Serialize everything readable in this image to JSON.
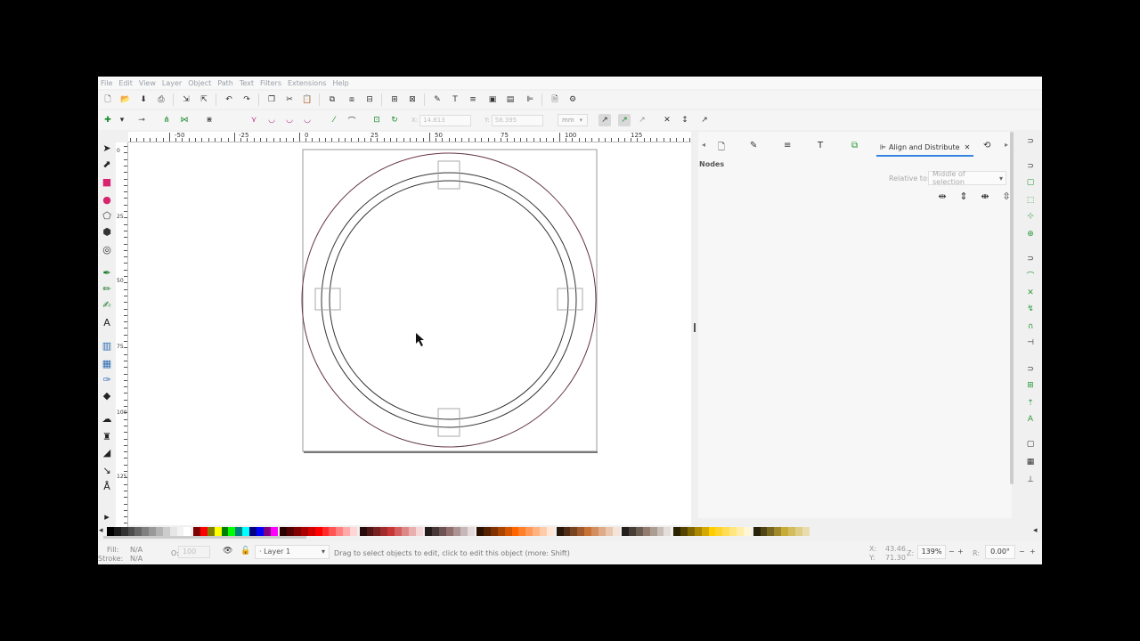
{
  "menu": [
    "File",
    "Edit",
    "View",
    "Layer",
    "Object",
    "Path",
    "Text",
    "Filters",
    "Extensions",
    "Help"
  ],
  "commands": [
    {
      "icon": "new-doc-icon",
      "glyph": "🗋"
    },
    {
      "icon": "open-icon",
      "glyph": "📂"
    },
    {
      "icon": "save-icon",
      "glyph": "⬇"
    },
    {
      "icon": "print-icon",
      "glyph": "⎙"
    },
    {
      "icon": "import-icon",
      "glyph": "⇲"
    },
    {
      "icon": "export-icon",
      "glyph": "⇱"
    },
    {
      "icon": "undo-icon",
      "glyph": "↶"
    },
    {
      "icon": "redo-icon",
      "glyph": "↷"
    },
    {
      "icon": "copy-icon",
      "glyph": "❐"
    },
    {
      "icon": "cut-icon",
      "glyph": "✂"
    },
    {
      "icon": "paste-icon",
      "glyph": "📋"
    },
    {
      "icon": "duplicate-icon",
      "glyph": "⧉"
    },
    {
      "icon": "clone-icon",
      "glyph": "⧈"
    },
    {
      "icon": "unlink-clone-icon",
      "glyph": "⊟"
    },
    {
      "icon": "group-icon",
      "glyph": "⊞"
    },
    {
      "icon": "ungroup-icon",
      "glyph": "⊠"
    },
    {
      "icon": "xml-editor-icon",
      "glyph": "✎"
    },
    {
      "icon": "text-font-icon",
      "glyph": "T"
    },
    {
      "icon": "layers-icon",
      "glyph": "≡"
    },
    {
      "icon": "objects-icon",
      "glyph": "▣"
    },
    {
      "icon": "selectors-icon",
      "glyph": "▤"
    },
    {
      "icon": "align-icon",
      "glyph": "⊫"
    },
    {
      "icon": "document-props-icon",
      "glyph": "🗎"
    },
    {
      "icon": "preferences-icon",
      "glyph": "⚙"
    }
  ],
  "node_controls": [
    {
      "icon": "insert-node-icon",
      "glyph": "✚",
      "tone": "green"
    },
    {
      "icon": "delete-node-icon",
      "glyph": "▾",
      "tone": ""
    },
    {
      "icon": "join-nodes-icon",
      "glyph": "⊸",
      "tone": ""
    },
    {
      "icon": "break-path-icon",
      "glyph": "⋔",
      "tone": "green"
    },
    {
      "icon": "join-endnodes-icon",
      "glyph": "⋈",
      "tone": "green"
    },
    {
      "icon": "delete-segment-icon",
      "glyph": "⋇",
      "tone": ""
    },
    {
      "icon": "corner-node-icon",
      "glyph": "⋎",
      "tone": "pink"
    },
    {
      "icon": "smooth-node-icon",
      "glyph": "◡",
      "tone": "pink"
    },
    {
      "icon": "symmetric-node-icon",
      "glyph": "◡",
      "tone": "pink"
    },
    {
      "icon": "auto-smooth-icon",
      "glyph": "◡",
      "tone": "pink"
    },
    {
      "icon": "make-line-icon",
      "glyph": "⁄",
      "tone": "green"
    },
    {
      "icon": "make-curve-icon",
      "glyph": "⌒",
      "tone": ""
    },
    {
      "icon": "object-to-path-icon",
      "glyph": "⊡",
      "tone": "green"
    },
    {
      "icon": "stroke-to-path-icon",
      "glyph": "↻",
      "tone": "green"
    }
  ],
  "coords": {
    "x_label": "X:",
    "x_value": "14.813",
    "y_label": "Y:",
    "y_value": "58.395",
    "unit": "mm"
  },
  "ctrl_right": [
    {
      "icon": "show-path-outline-icon",
      "glyph": "↗"
    },
    {
      "icon": "show-handles-icon",
      "glyph": "↗"
    },
    {
      "icon": "show-clipping-icon",
      "glyph": "↗"
    },
    {
      "icon": "show-transform-handles-icon",
      "glyph": "✕"
    },
    {
      "icon": "show-bbox-icon",
      "glyph": "↕"
    },
    {
      "icon": "next-path-effect-icon",
      "glyph": "↗"
    }
  ],
  "tools": [
    {
      "icon": "selector-tool-icon",
      "glyph": "➤",
      "color": "#222"
    },
    {
      "icon": "node-tool-icon",
      "glyph": "⬈",
      "color": "#222"
    },
    {
      "icon": "rect-tool-icon",
      "glyph": "■",
      "color": "#d6246e"
    },
    {
      "icon": "ellipse-tool-icon",
      "glyph": "●",
      "color": "#d6246e"
    },
    {
      "icon": "star-tool-icon",
      "glyph": "⬠",
      "color": "#333"
    },
    {
      "icon": "3dbox-tool-icon",
      "glyph": "⬢",
      "color": "#333"
    },
    {
      "icon": "spiral-tool-icon",
      "glyph": "◎",
      "color": "#333"
    },
    {
      "icon": "pen-tool-icon",
      "glyph": "✒",
      "color": "#1a7a2a"
    },
    {
      "icon": "pencil-tool-icon",
      "glyph": "✏",
      "color": "#1a7a2a"
    },
    {
      "icon": "calligraphy-tool-icon",
      "glyph": "✍",
      "color": "#1a7a2a"
    },
    {
      "icon": "text-tool-icon",
      "glyph": "A",
      "color": "#222"
    },
    {
      "icon": "gradient-tool-icon",
      "glyph": "▥",
      "color": "#2a6ab0"
    },
    {
      "icon": "mesh-tool-icon",
      "glyph": "▦",
      "color": "#2a6ab0"
    },
    {
      "icon": "dropper-tool-icon",
      "glyph": "✑",
      "color": "#2a6ab0"
    },
    {
      "icon": "paint-bucket-tool-icon",
      "glyph": "◆",
      "color": "#222"
    },
    {
      "icon": "tweak-tool-icon",
      "glyph": "☁",
      "color": "#222"
    },
    {
      "icon": "spray-tool-icon",
      "glyph": "♜",
      "color": "#222"
    },
    {
      "icon": "eraser-tool-icon",
      "glyph": "◢",
      "color": "#222"
    },
    {
      "icon": "connector-tool-icon",
      "glyph": "↘",
      "color": "#222"
    },
    {
      "icon": "measure-tool-icon",
      "glyph": "Å",
      "color": "#222"
    },
    {
      "icon": "expand-tools-icon",
      "glyph": "▸",
      "color": "#222"
    }
  ],
  "hruler": [
    "-50",
    "-25",
    "0",
    "25",
    "50",
    "75",
    "100",
    "125"
  ],
  "vruler": [
    "0",
    "25",
    "50",
    "75",
    "100",
    "125"
  ],
  "dock": {
    "tabs": [
      {
        "icon": "doc-props-tab-icon",
        "glyph": "🗋"
      },
      {
        "icon": "xml-tab-icon",
        "glyph": "✎"
      },
      {
        "icon": "layers-tab-icon",
        "glyph": "≡"
      },
      {
        "icon": "text-tab-icon",
        "glyph": "T"
      },
      {
        "icon": "export-tab-icon",
        "glyph": "⧉"
      }
    ],
    "active_tab": "Align and Distribute",
    "section": "Nodes",
    "relative_label": "Relative to:",
    "relative_value": "Middle of selection",
    "buttons": [
      {
        "icon": "align-nodes-horizontal-icon",
        "glyph": "⇹"
      },
      {
        "icon": "align-nodes-vertical-icon",
        "glyph": "⇕"
      },
      {
        "icon": "distribute-nodes-horizontal-icon",
        "glyph": "⇼"
      },
      {
        "icon": "distribute-nodes-vertical-icon",
        "glyph": "⇳"
      }
    ]
  },
  "snap": [
    {
      "icon": "snap-toggle-icon",
      "glyph": "⊃",
      "tone": ""
    },
    {
      "icon": "snap-bbox-icon",
      "glyph": "⊃",
      "tone": ""
    },
    {
      "icon": "snap-bbox-edge-icon",
      "glyph": "▢",
      "tone": "green"
    },
    {
      "icon": "snap-bbox-corner-icon",
      "glyph": "⬚",
      "tone": "green"
    },
    {
      "icon": "snap-bbox-midpoint-icon",
      "glyph": "⊹",
      "tone": "green"
    },
    {
      "icon": "snap-bbox-center-icon",
      "glyph": "⊕",
      "tone": "green"
    },
    {
      "icon": "snap-nodes-icon",
      "glyph": "⊃",
      "tone": ""
    },
    {
      "icon": "snap-path-icon",
      "glyph": "⌒",
      "tone": "green"
    },
    {
      "icon": "snap-intersection-icon",
      "glyph": "✕",
      "tone": "green"
    },
    {
      "icon": "snap-cusp-icon",
      "glyph": "↯",
      "tone": "green"
    },
    {
      "icon": "snap-smooth-icon",
      "glyph": "∩",
      "tone": "green"
    },
    {
      "icon": "snap-midpoint-icon",
      "glyph": "⊣",
      "tone": ""
    },
    {
      "icon": "snap-others-icon",
      "glyph": "⊃",
      "tone": ""
    },
    {
      "icon": "snap-object-center-icon",
      "glyph": "⊞",
      "tone": "green"
    },
    {
      "icon": "snap-rotation-center-icon",
      "glyph": "⇡",
      "tone": "green"
    },
    {
      "icon": "snap-text-baseline-icon",
      "glyph": "A",
      "tone": "green"
    },
    {
      "icon": "snap-page-icon",
      "glyph": "▢",
      "tone": ""
    },
    {
      "icon": "snap-grid-icon",
      "glyph": "▦",
      "tone": ""
    },
    {
      "icon": "snap-guide-icon",
      "glyph": "⊥",
      "tone": ""
    }
  ],
  "palette_colors": [
    "#000000",
    "#1a1a1a",
    "#333333",
    "#4d4d4d",
    "#666666",
    "#808080",
    "#999999",
    "#b3b3b3",
    "#cccccc",
    "#e6e6e6",
    "#f2f2f2",
    "#ffffff",
    "#800000",
    "#ff0000",
    "#808000",
    "#ffff00",
    "#008000",
    "#00ff00",
    "#008080",
    "#00ffff",
    "#000080",
    "#0000ff",
    "#800080",
    "#ff00ff",
    "#2b0000",
    "#550000",
    "#800000",
    "#aa0000",
    "#d40000",
    "#ff0000",
    "#ff2a2a",
    "#ff5555",
    "#ff8080",
    "#ffaaaa",
    "#ffd5d5",
    "#280b0b",
    "#501616",
    "#782121",
    "#a02c2c",
    "#c83737",
    "#d35f5f",
    "#de8787",
    "#e9afaf",
    "#f4d7d7",
    "#241c1c",
    "#483737",
    "#6c5353",
    "#916f6f",
    "#ac9393",
    "#c8b7b7",
    "#e3dbdb",
    "#2b1100",
    "#552200",
    "#803300",
    "#aa4400",
    "#d45500",
    "#ff6600",
    "#ff7f2a",
    "#ff9955",
    "#ffb380",
    "#ffccaa",
    "#ffe6d5",
    "#28170b",
    "#502d16",
    "#784421",
    "#a05a2c",
    "#c87137",
    "#d38d5f",
    "#deaa87",
    "#e9c6af",
    "#f4e3d7",
    "#241f1c",
    "#483e37",
    "#6c5d53",
    "#917c6f",
    "#ac9d93",
    "#c8beb7",
    "#e3dedb",
    "#2b2200",
    "#554400",
    "#806600",
    "#aa8800",
    "#d4aa00",
    "#ffcc00",
    "#ffd42a",
    "#ffdd55",
    "#ffe680",
    "#ffeeaa",
    "#fff6d5",
    "#28220b",
    "#504416",
    "#786721",
    "#a0892c",
    "#c8ab37",
    "#d3bc5f",
    "#decd87",
    "#e9ddaf"
  ],
  "status": {
    "fill_label": "Fill:",
    "fill_value": "N/A",
    "stroke_label": "Stroke:",
    "stroke_value": "N/A",
    "opacity_label": "O:",
    "opacity_value": "100",
    "layer": "Layer 1",
    "message": "Drag to select objects to edit, click to edit this object (more: Shift)",
    "x_label": "X:",
    "x_value": "43.46",
    "y_label": "Y:",
    "y_value": "71.30",
    "zoom_label": "Z:",
    "zoom_value": "139%",
    "rotate_label": "R:",
    "rotate_value": "0.00°"
  }
}
